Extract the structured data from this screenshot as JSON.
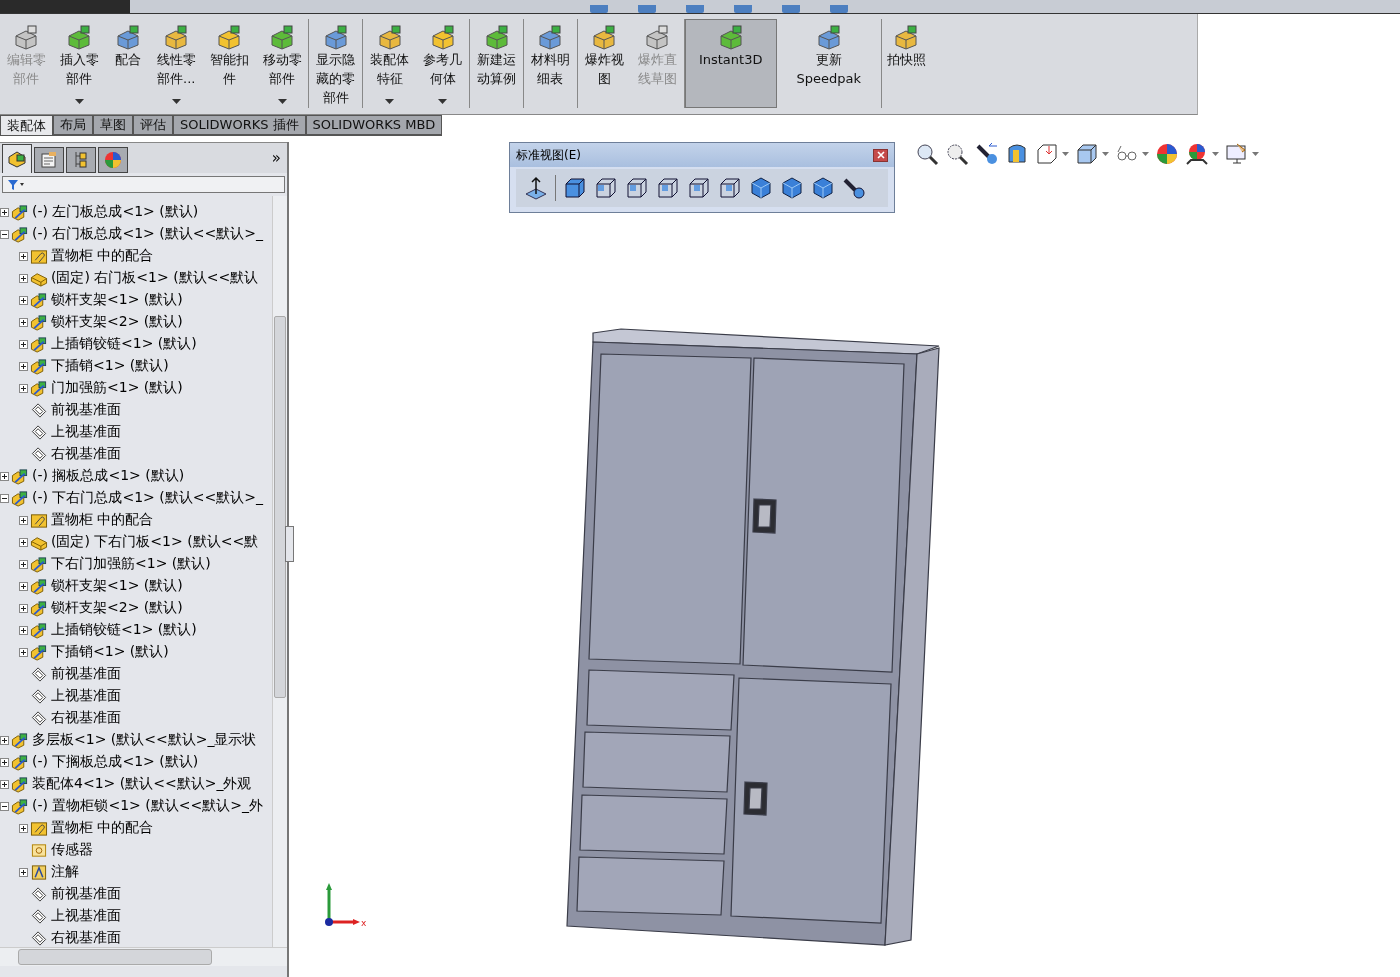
{
  "command_groups": [
    [
      {
        "label": "编辑零部件",
        "disabled": true,
        "menu": false
      },
      {
        "label": "插入零部件",
        "disabled": false,
        "menu": true
      },
      {
        "label": "配合",
        "disabled": false,
        "menu": false
      },
      {
        "label": "线性零部件...",
        "disabled": false,
        "menu": true
      },
      {
        "label": "智能扣件",
        "disabled": false,
        "menu": false
      },
      {
        "label": "移动零部件",
        "disabled": false,
        "menu": true
      }
    ],
    [
      {
        "label": "显示隐藏的零部件",
        "disabled": false,
        "menu": false
      }
    ],
    [
      {
        "label": "装配体特征",
        "disabled": false,
        "menu": true
      },
      {
        "label": "参考几何体",
        "disabled": false,
        "menu": true
      }
    ],
    [
      {
        "label": "新建运动算例",
        "disabled": false,
        "menu": false
      }
    ],
    [
      {
        "label": "材料明细表",
        "disabled": false,
        "menu": false
      }
    ],
    [
      {
        "label": "爆炸视图",
        "disabled": false,
        "menu": false
      },
      {
        "label": "爆炸直线草图",
        "disabled": true,
        "menu": false
      }
    ],
    [
      {
        "label": "Instant3D",
        "disabled": false,
        "menu": false,
        "selected": true
      },
      {
        "label": "更新 Speedpak",
        "disabled": false,
        "menu": false,
        "selected": false
      }
    ],
    [
      {
        "label": "拍快照",
        "disabled": false,
        "menu": false
      }
    ]
  ],
  "tabs": [
    {
      "label": "装配体",
      "selected": true
    },
    {
      "label": "布局",
      "selected": false
    },
    {
      "label": "草图",
      "selected": false
    },
    {
      "label": "评估",
      "selected": false
    },
    {
      "label": "SOLIDWORKS 插件",
      "selected": false
    },
    {
      "label": "SOLIDWORKS MBD",
      "selected": false
    }
  ],
  "panel_tabs": [
    {
      "selected": true
    },
    {
      "selected": false
    },
    {
      "selected": false
    },
    {
      "selected": false
    }
  ],
  "panel_more": "»",
  "tree": [
    {
      "kind": "assembly",
      "label": "(-) 左门板总成<1> (默认)",
      "expanded": false
    },
    {
      "kind": "assembly",
      "label": "(-) 右门板总成<1> (默认<<默认>_",
      "expanded": true,
      "children": [
        {
          "kind": "mates",
          "label": "置物柜 中的配合",
          "expanded": false
        },
        {
          "kind": "part",
          "label": "(固定) 右门板<1> (默认<<默认",
          "expanded": false
        },
        {
          "kind": "assembly",
          "label": "锁杆支架<1> (默认)",
          "expanded": false
        },
        {
          "kind": "assembly",
          "label": "锁杆支架<2> (默认)",
          "expanded": false
        },
        {
          "kind": "assembly",
          "label": "上插销铰链<1> (默认)",
          "expanded": false
        },
        {
          "kind": "assembly",
          "label": "下插销<1> (默认)",
          "expanded": false
        },
        {
          "kind": "assembly",
          "label": "门加强筋<1> (默认)",
          "expanded": false
        },
        {
          "kind": "plane",
          "label": "前视基准面"
        },
        {
          "kind": "plane",
          "label": "上视基准面"
        },
        {
          "kind": "plane",
          "label": "右视基准面"
        }
      ]
    },
    {
      "kind": "assembly",
      "label": "(-) 搁板总成<1> (默认)",
      "expanded": false
    },
    {
      "kind": "assembly",
      "label": "(-) 下右门总成<1> (默认<<默认>_",
      "expanded": true,
      "children": [
        {
          "kind": "mates",
          "label": "置物柜 中的配合",
          "expanded": false
        },
        {
          "kind": "part",
          "label": "(固定) 下右门板<1> (默认<<默",
          "expanded": false
        },
        {
          "kind": "assembly",
          "label": "下右门加强筋<1> (默认)",
          "expanded": false
        },
        {
          "kind": "assembly",
          "label": "锁杆支架<1> (默认)",
          "expanded": false
        },
        {
          "kind": "assembly",
          "label": "锁杆支架<2> (默认)",
          "expanded": false
        },
        {
          "kind": "assembly",
          "label": "上插销铰链<1> (默认)",
          "expanded": false
        },
        {
          "kind": "assembly",
          "label": "下插销<1> (默认)",
          "expanded": false
        },
        {
          "kind": "plane",
          "label": "前视基准面"
        },
        {
          "kind": "plane",
          "label": "上视基准面"
        },
        {
          "kind": "plane",
          "label": "右视基准面"
        }
      ]
    },
    {
      "kind": "assembly",
      "label": "多层板<1> (默认<<默认>_显示状",
      "expanded": false
    },
    {
      "kind": "assembly",
      "label": "(-) 下搁板总成<1> (默认)",
      "expanded": false
    },
    {
      "kind": "assembly",
      "label": "装配体4<1> (默认<<默认>_外观",
      "expanded": false
    },
    {
      "kind": "assembly",
      "label": "(-) 置物柜锁<1> (默认<<默认>_外",
      "expanded": true,
      "children": [
        {
          "kind": "mates",
          "label": "置物柜 中的配合",
          "expanded": false
        },
        {
          "kind": "sensor",
          "label": "传感器"
        },
        {
          "kind": "annotation",
          "label": "注解",
          "expanded": false
        },
        {
          "kind": "plane",
          "label": "前视基准面"
        },
        {
          "kind": "plane",
          "label": "上视基准面"
        },
        {
          "kind": "plane",
          "label": "右视基准面"
        }
      ]
    }
  ],
  "view_toolbar": {
    "title": "标准视图(E)"
  },
  "triad": {
    "x_label": "x"
  }
}
